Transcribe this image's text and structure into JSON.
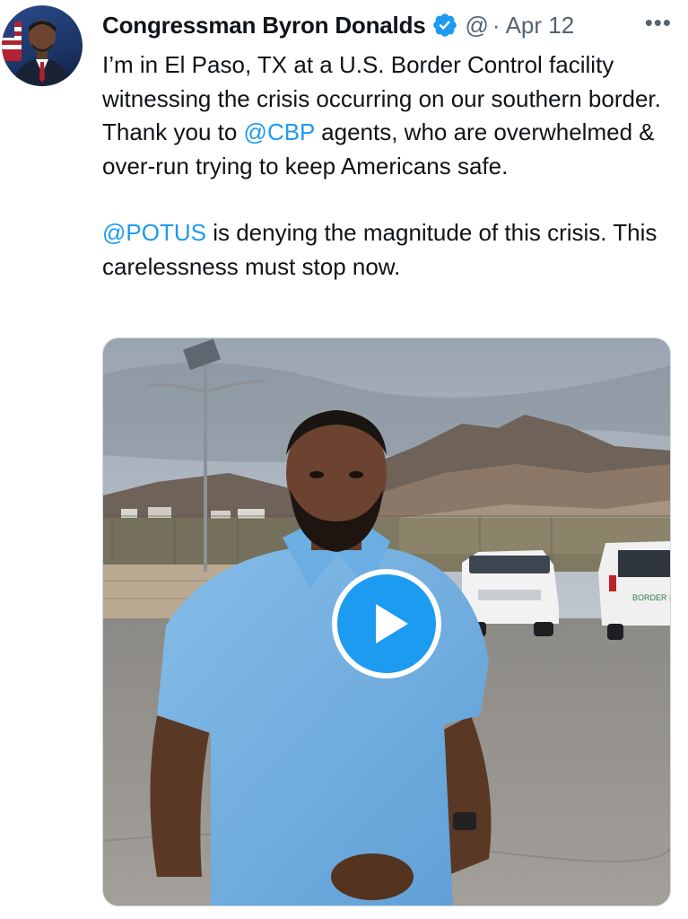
{
  "tweet": {
    "author_name": "Congressman Byron Donalds",
    "handle": "@",
    "separator": "·",
    "date": "Apr 12",
    "more_label": "•••",
    "text": {
      "p1_a": "I’m in El Paso, TX at a U.S. Border Control facility witnessing the crisis occurring on our southern border. Thank you to ",
      "p1_mention": "@CBP",
      "p1_b": " agents, who are overwhelmed & over-run trying to keep Americans safe.",
      "p2_mention": "@POTUS",
      "p2_b": " is denying the magnitude of this crisis. This carelessness must stop now."
    }
  },
  "media": {
    "type": "video",
    "play_icon": "play-icon",
    "van_text": "BORDER PA"
  },
  "colors": {
    "link": "#1d9bf0",
    "verified": "#1d9bf0",
    "secondary_text": "#536471",
    "play_button": "#1d9bf0"
  }
}
